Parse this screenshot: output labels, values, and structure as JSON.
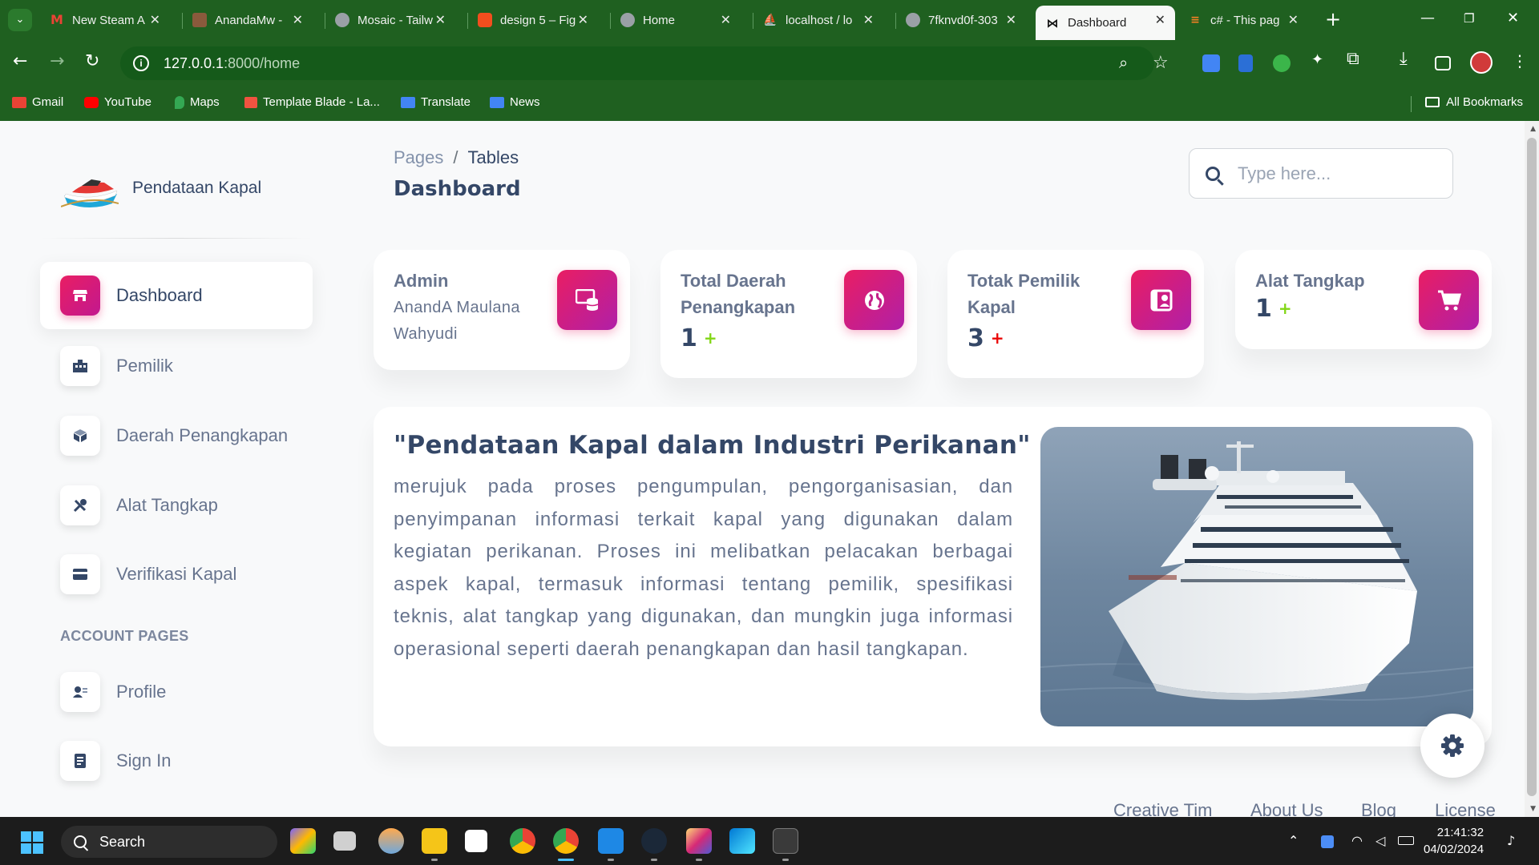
{
  "browser": {
    "tabs": [
      {
        "title": "New Steam A",
        "icon": "gmail-icon",
        "color": "#ea4335"
      },
      {
        "title": "AnandaMw -",
        "icon": "github-avatar-icon",
        "color": "#8a5a3c"
      },
      {
        "title": "Mosaic - Tailw",
        "icon": "globe-icon",
        "color": "#9aa0a6"
      },
      {
        "title": "design 5 – Fig",
        "icon": "figma-icon",
        "color": "#f24e1e"
      },
      {
        "title": "Home",
        "icon": "globe-icon",
        "color": "#9aa0a6"
      },
      {
        "title": "localhost / lo",
        "icon": "phpmyadmin-icon",
        "color": "#f29111"
      },
      {
        "title": "7fknvd0f-303",
        "icon": "globe-icon",
        "color": "#9aa0a6"
      },
      {
        "title": "Dashboard",
        "icon": "bowtie-icon",
        "color": "#111111"
      },
      {
        "title": "c# - This pag",
        "icon": "stackoverflow-icon",
        "color": "#f48024"
      }
    ],
    "active_tab": 7,
    "url_host": "127.0.0.1",
    "url_path": ":8000/home",
    "bookmarks": [
      {
        "label": "Gmail",
        "color": "#ea4335"
      },
      {
        "label": "YouTube",
        "color": "#ff0000"
      },
      {
        "label": "Maps",
        "color": "#34a853"
      },
      {
        "label": "Template Blade - La...",
        "color": "#f05340"
      },
      {
        "label": "Translate",
        "color": "#4285f4"
      },
      {
        "label": "News",
        "color": "#4285f4"
      }
    ],
    "all_bookmarks": "All Bookmarks"
  },
  "sidebar": {
    "brand": "Pendataan Kapal",
    "items": [
      {
        "label": "Dashboard",
        "icon": "shop-icon",
        "active": true
      },
      {
        "label": "Pemilik",
        "icon": "office-icon"
      },
      {
        "label": "Daerah Penangkapan",
        "icon": "box-icon"
      },
      {
        "label": "Alat Tangkap",
        "icon": "tools-icon"
      },
      {
        "label": "Verifikasi Kapal",
        "icon": "credit-card-icon"
      }
    ],
    "section_title": "ACCOUNT PAGES",
    "account_items": [
      {
        "label": "Profile",
        "icon": "user-icon"
      },
      {
        "label": "Sign In",
        "icon": "document-icon"
      }
    ]
  },
  "header": {
    "breadcrumb_root": "Pages",
    "breadcrumb_current": "Tables",
    "title": "Dashboard",
    "search_placeholder": "Type here..."
  },
  "stats": [
    {
      "label": "Admin",
      "sub": "AnandA Maulana Wahyudi",
      "icon": "database-icon"
    },
    {
      "label": "Total Daerah Penangkapan",
      "value": "1",
      "change": "+",
      "change_color": "#82d616",
      "icon": "globe-icon"
    },
    {
      "label": "Totak Pemilik Kapal",
      "value": "3",
      "change": "+",
      "change_color": "#ea0606",
      "icon": "id-card-icon"
    },
    {
      "label": "Alat Tangkap",
      "value": "1",
      "change": "+",
      "change_color": "#82d616",
      "icon": "cart-icon"
    }
  ],
  "intro": {
    "title": "\"Pendataan Kapal dalam Industri Perikanan\"",
    "body": "merujuk pada proses pengumpulan, pengorganisasian, dan penyimpanan informasi terkait kapal yang digunakan dalam kegiatan perikanan. Proses ini melibatkan pelacakan berbagai aspek kapal, termasuk informasi tentang pemilik, spesifikasi teknis, alat tangkap yang digunakan, dan mungkin juga informasi operasional seperti daerah penangkapan dan hasil tangkapan."
  },
  "footer": [
    "Creative Tim",
    "About Us",
    "Blog",
    "License"
  ],
  "taskbar": {
    "search": "Search",
    "time": "21:41:32",
    "date": "04/02/2024"
  },
  "colors": {
    "accent": "#e91e63",
    "browser_green": "#1f6020",
    "text_dark": "#344767",
    "text_muted": "#67748e"
  }
}
